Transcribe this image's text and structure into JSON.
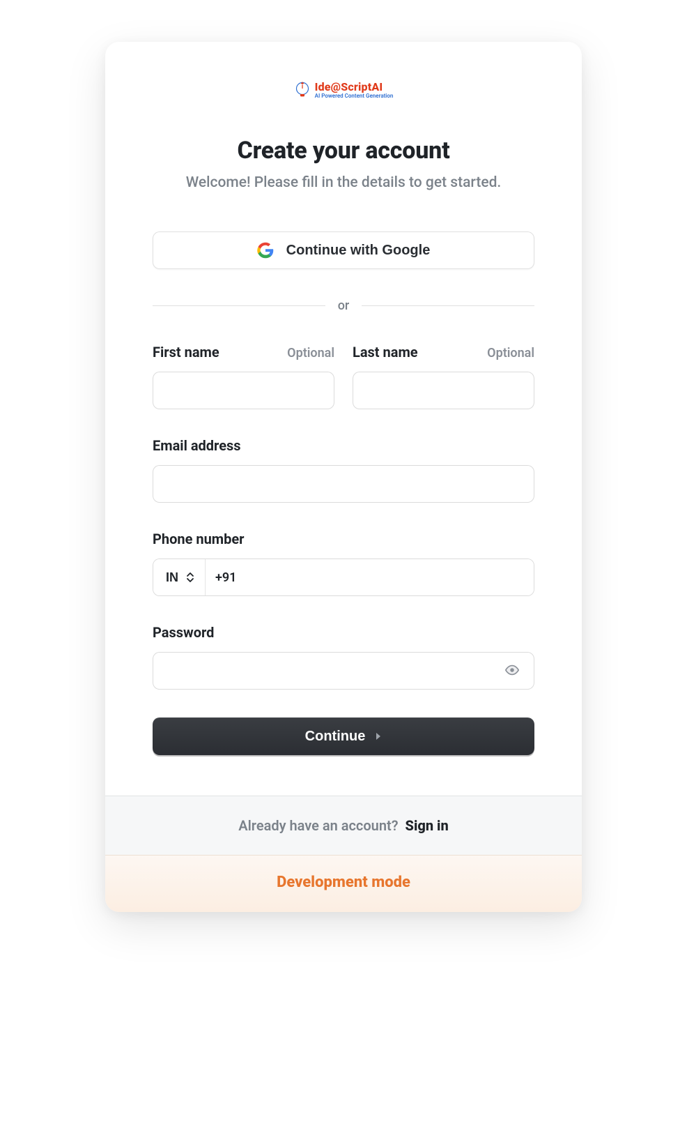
{
  "logo": {
    "title": "Ide@ScriptAI",
    "subtitle": "AI Powered Content Generation"
  },
  "header": {
    "title": "Create your account",
    "subtitle": "Welcome! Please fill in the details to get started."
  },
  "social": {
    "google_label": "Continue with Google"
  },
  "divider": {
    "or": "or"
  },
  "form": {
    "first_name": {
      "label": "First name",
      "optional": "Optional",
      "value": ""
    },
    "last_name": {
      "label": "Last name",
      "optional": "Optional",
      "value": ""
    },
    "email": {
      "label": "Email address",
      "value": ""
    },
    "phone": {
      "label": "Phone number",
      "country_code": "IN",
      "dial_prefix": "+91",
      "value": ""
    },
    "password": {
      "label": "Password",
      "value": ""
    },
    "continue_label": "Continue"
  },
  "footer": {
    "prompt": "Already have an account?",
    "signin": "Sign in"
  },
  "dev": {
    "label": "Development mode"
  }
}
